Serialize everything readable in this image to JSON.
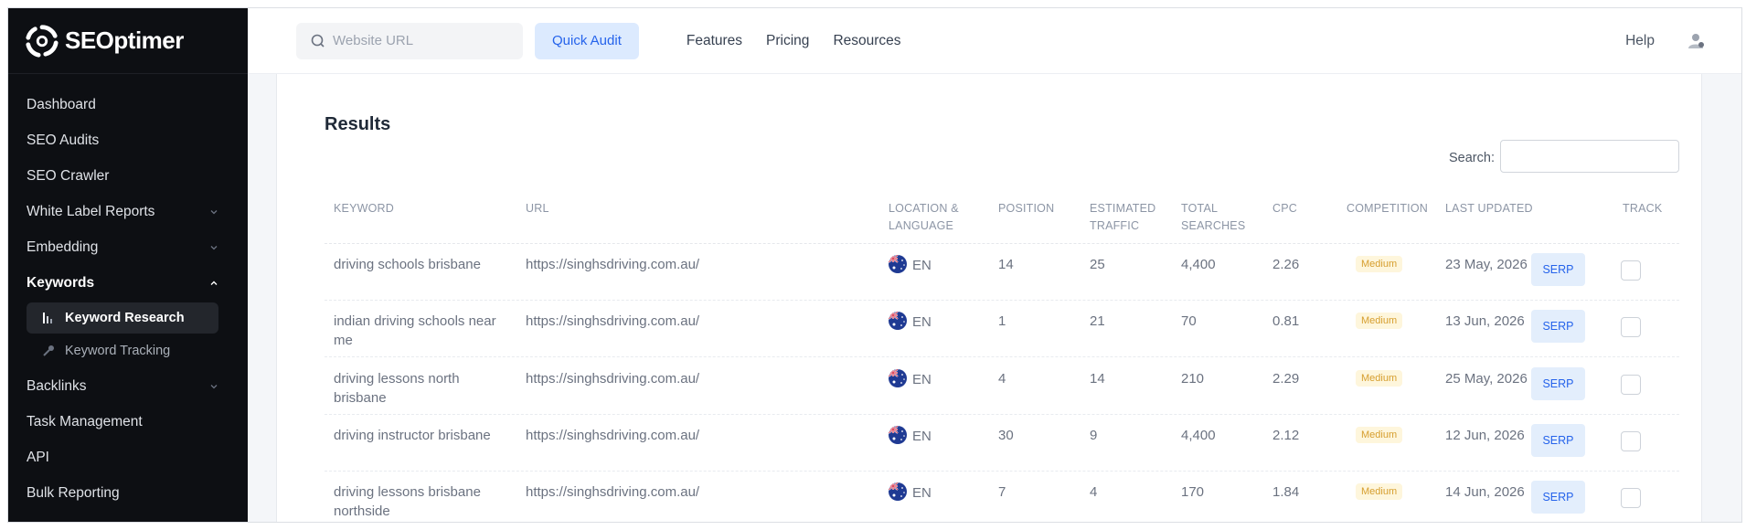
{
  "brand": {
    "name": "SEOptimer"
  },
  "topbar": {
    "search_placeholder": "Website URL",
    "quick_audit": "Quick Audit",
    "links": [
      "Features",
      "Pricing",
      "Resources"
    ],
    "help": "Help"
  },
  "sidebar": {
    "items": [
      {
        "label": "Dashboard"
      },
      {
        "label": "SEO Audits"
      },
      {
        "label": "SEO Crawler"
      },
      {
        "label": "White Label Reports"
      },
      {
        "label": "Embedding"
      },
      {
        "label": "Keywords"
      },
      {
        "label": "Backlinks"
      },
      {
        "label": "Task Management"
      },
      {
        "label": "API"
      },
      {
        "label": "Bulk Reporting"
      }
    ],
    "sub_items": [
      {
        "label": "Keyword Research"
      },
      {
        "label": "Keyword Tracking"
      }
    ]
  },
  "main": {
    "title": "Results",
    "search_label": "Search:",
    "columns": [
      "Keyword",
      "URL",
      "Location & Language",
      "Position",
      "Estimated Traffic",
      "Total Searches",
      "CPC",
      "Competition",
      "Last Updated",
      "",
      "Track"
    ],
    "rows": [
      {
        "keyword": "driving schools brisbane",
        "url": "https://singhsdriving.com.au/",
        "lang": "EN",
        "position": "14",
        "traffic": "25",
        "searches": "4,400",
        "cpc": "2.26",
        "competition": "Medium",
        "updated": "23 May, 2026",
        "serp": "SERP"
      },
      {
        "keyword": "indian driving schools near me",
        "url": "https://singhsdriving.com.au/",
        "lang": "EN",
        "position": "1",
        "traffic": "21",
        "searches": "70",
        "cpc": "0.81",
        "competition": "Medium",
        "updated": "13 Jun, 2026",
        "serp": "SERP"
      },
      {
        "keyword": "driving lessons north brisbane",
        "url": "https://singhsdriving.com.au/",
        "lang": "EN",
        "position": "4",
        "traffic": "14",
        "searches": "210",
        "cpc": "2.29",
        "competition": "Medium",
        "updated": "25 May, 2026",
        "serp": "SERP"
      },
      {
        "keyword": "driving instructor brisbane",
        "url": "https://singhsdriving.com.au/",
        "lang": "EN",
        "position": "30",
        "traffic": "9",
        "searches": "4,400",
        "cpc": "2.12",
        "competition": "Medium",
        "updated": "12 Jun, 2026",
        "serp": "SERP"
      },
      {
        "keyword": "driving lessons brisbane northside",
        "url": "https://singhsdriving.com.au/",
        "lang": "EN",
        "position": "7",
        "traffic": "4",
        "searches": "170",
        "cpc": "1.84",
        "competition": "Medium",
        "updated": "14 Jun, 2026",
        "serp": "SERP"
      }
    ]
  },
  "colors": {
    "sidebar_bg": "#0d0f13",
    "accent": "#2563eb",
    "badge": "#d69e2e"
  }
}
